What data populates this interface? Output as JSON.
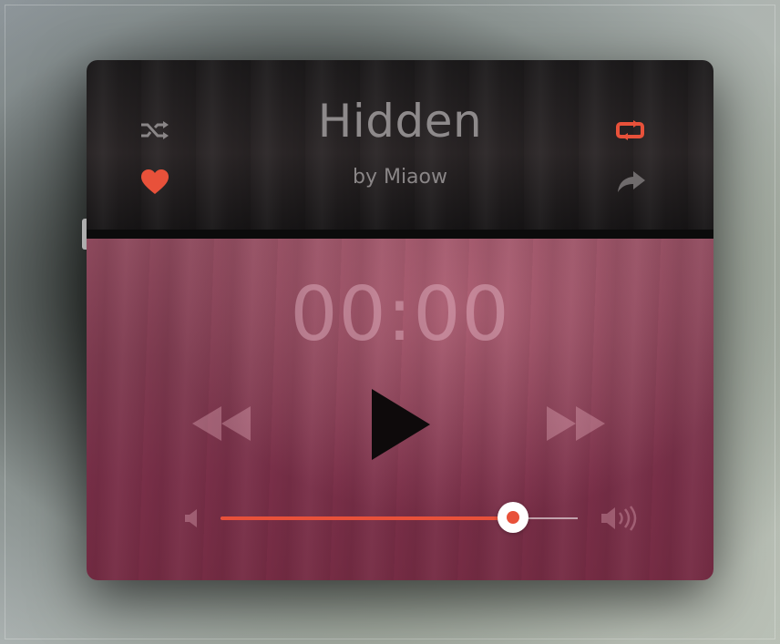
{
  "track": {
    "title": "Hidden",
    "artist": "by Miaow",
    "elapsed": "00:00",
    "progress": 0.82
  },
  "icons": {
    "shuffle": "shuffle-icon",
    "repeat": "repeat-icon",
    "favorite": "heart-icon",
    "share": "share-icon",
    "rewind": "rewind-icon",
    "play": "play-icon",
    "fast_forward": "fast-forward-icon",
    "volume_low": "volume-low-icon",
    "volume_high": "volume-high-icon"
  },
  "colors": {
    "accent": "#e8513a",
    "top_panel": "#221f20",
    "bottom_panel": "#7f3b50",
    "muted_icon": "#8a8687"
  }
}
